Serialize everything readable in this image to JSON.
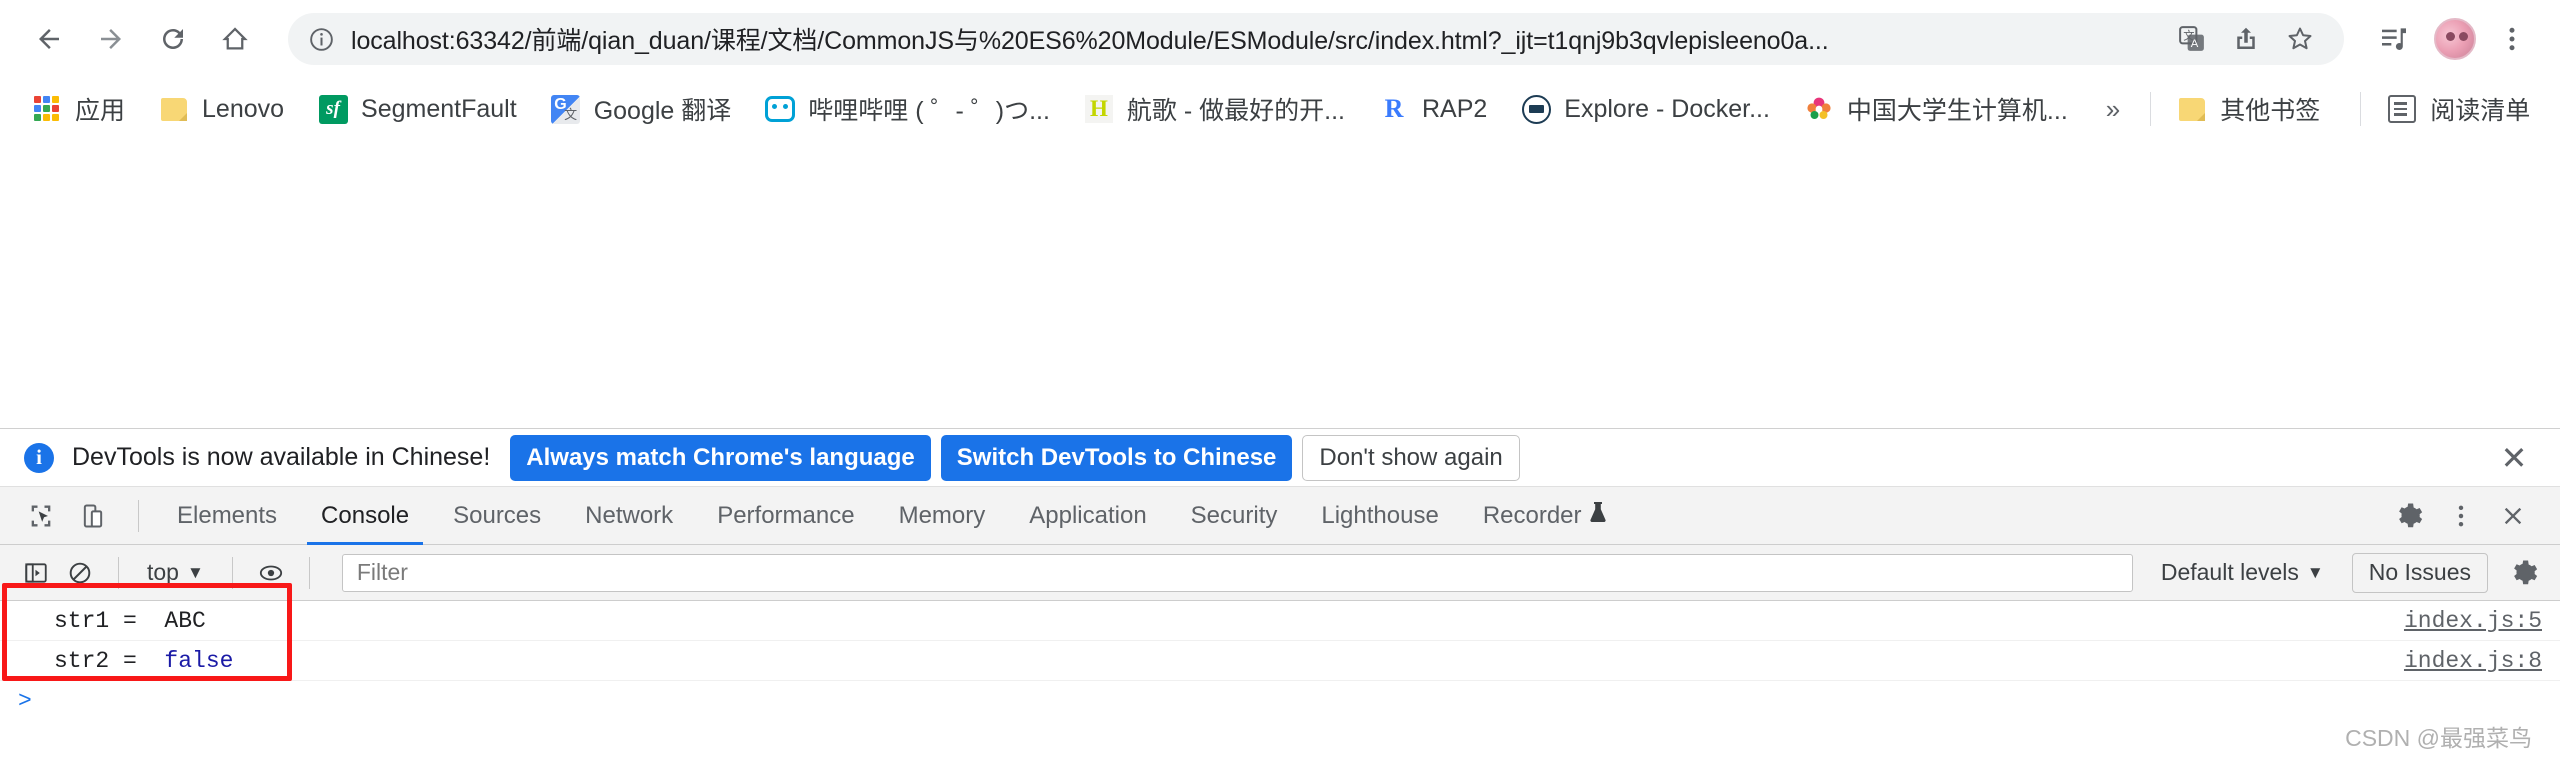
{
  "browser": {
    "nav": {
      "back": "back-arrow",
      "forward": "forward-arrow",
      "reload": "reload",
      "home": "home"
    },
    "omnibox": {
      "security_icon": "info-circle-icon",
      "url": "localhost:63342/前端/qian_duan/课程/文档/CommonJS与%20ES6%20Module/ESModule/src/index.html?_ijt=t1qnj9b3qvlepisleeno0a...",
      "translate_icon": "translate-icon",
      "share_icon": "share-icon",
      "bookmark_icon": "star-icon"
    },
    "toolbar_right": {
      "media_icon": "media-control-icon",
      "profile_icon": "profile-avatar",
      "menu_icon": "three-dot-menu-icon"
    }
  },
  "bookmarks": {
    "items": [
      {
        "label": "应用",
        "icon": "apps-grid-icon"
      },
      {
        "label": "Lenovo",
        "icon": "folder-icon"
      },
      {
        "label": "SegmentFault",
        "icon": "segmentfault-icon"
      },
      {
        "label": "Google 翻译",
        "icon": "google-translate-icon"
      },
      {
        "label": "哔哩哔哩 ( ゜- ゜)つ...",
        "icon": "bilibili-icon"
      },
      {
        "label": "航歌 - 做最好的开...",
        "icon": "hangge-icon"
      },
      {
        "label": "RAP2",
        "icon": "rap2-icon"
      },
      {
        "label": "Explore - Docker...",
        "icon": "docker-icon"
      },
      {
        "label": "中国大学生计算机...",
        "icon": "china-contest-icon"
      }
    ],
    "overflow": "»",
    "other_bookmarks": {
      "label": "其他书签",
      "icon": "folder-icon"
    },
    "reading_list": {
      "label": "阅读清单",
      "icon": "reading-list-icon"
    }
  },
  "devtools": {
    "banner": {
      "icon": "info-icon",
      "message": "DevTools is now available in Chinese!",
      "primary_button": "Always match Chrome's language",
      "secondary_button": "Switch DevTools to Chinese",
      "dismiss_button": "Don't show again",
      "close_icon": "close-icon"
    },
    "tools": {
      "inspect_icon": "inspect-element-icon",
      "device_icon": "device-toolbar-icon",
      "settings_icon": "gear-icon",
      "more_icon": "three-dot-vertical-icon",
      "close_icon": "close-icon"
    },
    "tabs": [
      {
        "label": "Elements",
        "active": false
      },
      {
        "label": "Console",
        "active": true
      },
      {
        "label": "Sources",
        "active": false
      },
      {
        "label": "Network",
        "active": false
      },
      {
        "label": "Performance",
        "active": false
      },
      {
        "label": "Memory",
        "active": false
      },
      {
        "label": "Application",
        "active": false
      },
      {
        "label": "Security",
        "active": false
      },
      {
        "label": "Lighthouse",
        "active": false
      },
      {
        "label": "Recorder",
        "active": false
      }
    ],
    "recorder_badge": "🧪",
    "filterbar": {
      "sidebar_icon": "console-sidebar-icon",
      "clear_icon": "clear-console-icon",
      "context": "top",
      "context_caret": "▼",
      "eye_icon": "live-expression-icon",
      "filter_placeholder": "Filter",
      "filter_value": "",
      "levels_label": "Default levels",
      "levels_caret": "▼",
      "issues_label": "No Issues",
      "settings_icon": "gear-icon"
    },
    "console": {
      "rows": [
        {
          "message": "str1 =  ",
          "value": "ABC",
          "value_type": "string",
          "source": "index.js:5"
        },
        {
          "message": "str2 =  ",
          "value": "false",
          "value_type": "boolean",
          "source": "index.js:8"
        }
      ],
      "prompt": ">",
      "highlight_color": "#f81818"
    },
    "watermark": "CSDN @最强菜鸟"
  }
}
